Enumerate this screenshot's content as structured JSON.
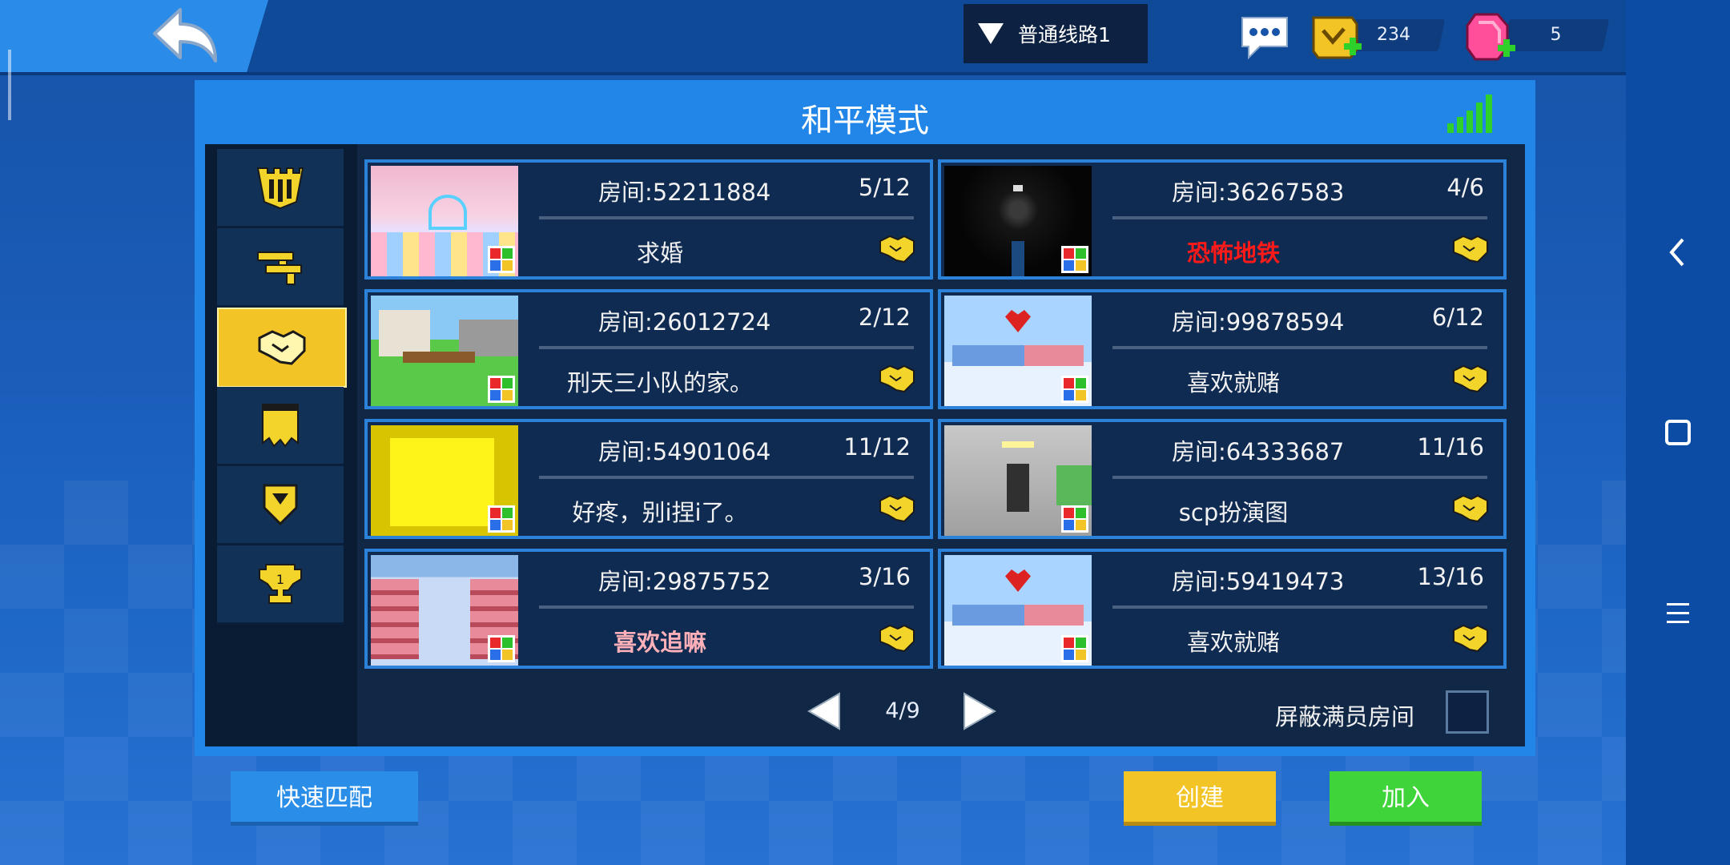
{
  "topbar": {
    "route_label": "普通线路1",
    "coins": "234",
    "gems": "5"
  },
  "panel": {
    "title": "和平模式"
  },
  "sidebar": {
    "items": [
      {
        "icon": "castle-icon"
      },
      {
        "icon": "guns-icon"
      },
      {
        "icon": "handshake-icon",
        "active": true
      },
      {
        "icon": "flag-icon"
      },
      {
        "icon": "shield-icon"
      },
      {
        "icon": "trophy-icon"
      }
    ]
  },
  "rooms": [
    {
      "room": "房间:52211884",
      "count": "5/12",
      "name": "求婚",
      "name_color": "#f2f2f2"
    },
    {
      "room": "房间:36267583",
      "count": "4/6",
      "name": "恐怖地铁",
      "name_color": "#ff1a1a"
    },
    {
      "room": "房间:26012724",
      "count": "2/12",
      "name": "刑天三小队的家。",
      "name_color": "#f2f2f2"
    },
    {
      "room": "房间:99878594",
      "count": "6/12",
      "name": "喜欢就赌",
      "name_color": "#f2f2f2"
    },
    {
      "room": "房间:54901064",
      "count": "11/12",
      "name": "好疼，别i捏i了。",
      "name_color": "#f2f2f2"
    },
    {
      "room": "房间:64333687",
      "count": "11/16",
      "name": "scp扮演图",
      "name_color": "#f2f2f2"
    },
    {
      "room": "房间:29875752",
      "count": "3/16",
      "name": "喜欢追嘛",
      "name_color": "#ffb0b8"
    },
    {
      "room": "房间:59419473",
      "count": "13/16",
      "name": "喜欢就赌",
      "name_color": "#f2f2f2"
    }
  ],
  "pager": {
    "page": "4/9"
  },
  "hide_full_label": "屏蔽满员房间",
  "buttons": {
    "quick_match": "快速匹配",
    "create": "创建",
    "join": "加入"
  }
}
